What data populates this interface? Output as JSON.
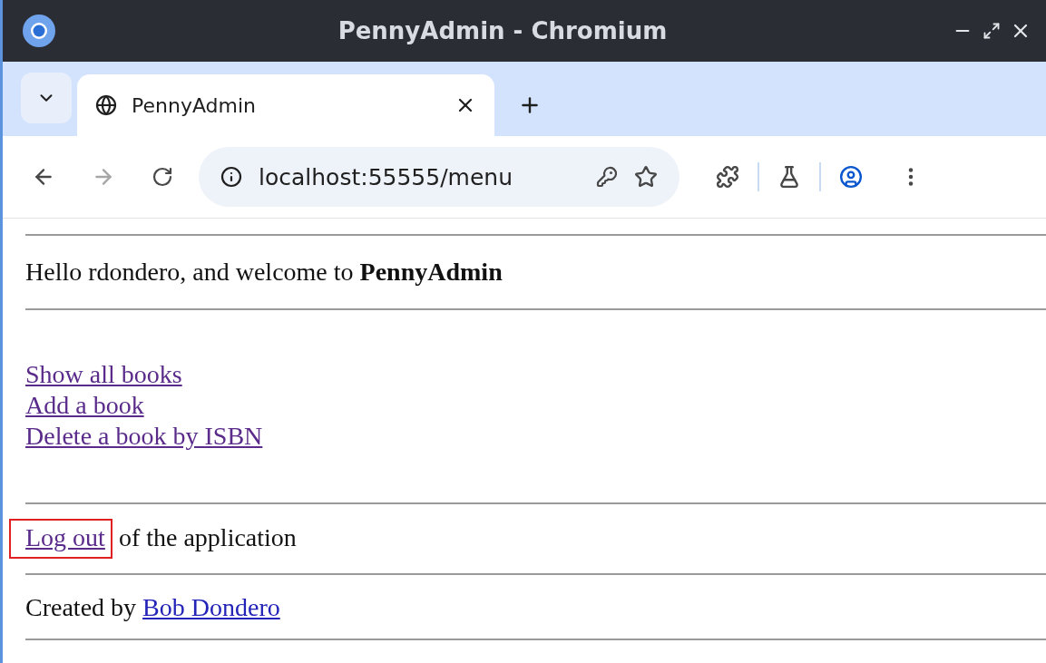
{
  "window": {
    "title": "PennyAdmin - Chromium"
  },
  "tabs": [
    {
      "label": "PennyAdmin",
      "selected": true
    }
  ],
  "address_bar": {
    "url": "localhost:55555/menu"
  },
  "page": {
    "greeting": "Hello rdondero, and welcome to **PennyAdmin**",
    "menu_links": [
      {
        "label": "Show all books",
        "visited": true
      },
      {
        "label": "Add a book",
        "visited": true
      },
      {
        "label": "Delete a book by ISBN",
        "visited": true
      }
    ],
    "logout": {
      "link": {
        "label": "Log out",
        "visited": true,
        "highlighted": true
      },
      "text": "of the application"
    },
    "footer": {
      "text": "Created by",
      "link": {
        "label": "Bob Dondero",
        "visited": false
      }
    }
  }
}
